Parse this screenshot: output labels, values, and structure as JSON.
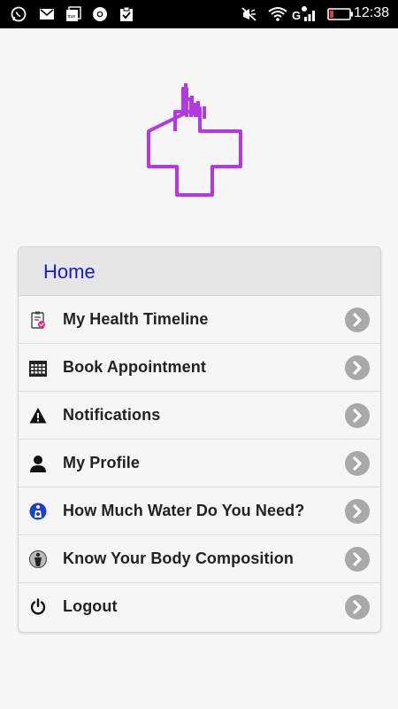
{
  "status_bar": {
    "time": "12:38",
    "left_icons": [
      "whatsapp-icon",
      "gmail-icon",
      "truecaller-icon",
      "chrome-icon",
      "clipboard-icon"
    ],
    "right_icons": [
      "mute-icon",
      "wifi-icon",
      "signal-icon",
      "battery-icon"
    ]
  },
  "logo": {
    "icon": "medical-cross-hand-logo",
    "color": "#b23be0"
  },
  "menu": {
    "title": "Home",
    "title_color": "#1c17d9",
    "items": [
      {
        "label": "My Health Timeline",
        "icon": "health-timeline-icon"
      },
      {
        "label": "Book Appointment",
        "icon": "calendar-icon"
      },
      {
        "label": "Notifications",
        "icon": "warning-icon"
      },
      {
        "label": "My Profile",
        "icon": "user-icon"
      },
      {
        "label": "How Much Water Do You Need?",
        "icon": "water-person-icon"
      },
      {
        "label": "Know Your Body Composition",
        "icon": "body-composition-icon"
      },
      {
        "label": "Logout",
        "icon": "power-icon"
      }
    ]
  }
}
